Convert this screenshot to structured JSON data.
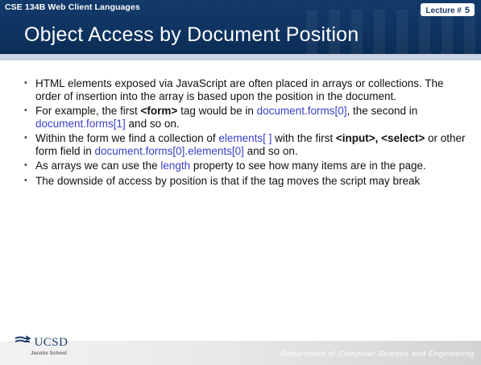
{
  "header": {
    "course": "CSE 134B  Web Client Languages",
    "lecture_label": "Lecture #",
    "lecture_number": "5",
    "title": "Object Access by Document Position"
  },
  "bullets": [
    {
      "parts": [
        {
          "text": "HTML elements exposed via JavaScript are often placed in arrays or collections.  The order of insertion into the array is based upon the position in the document."
        }
      ]
    },
    {
      "parts": [
        {
          "text": "For example, the first "
        },
        {
          "text": "<form>",
          "style": "bold"
        },
        {
          "text": " tag would be in "
        },
        {
          "text": "document.forms[0]",
          "style": "code"
        },
        {
          "text": ", the second in "
        },
        {
          "text": "document.forms[1]",
          "style": "code"
        },
        {
          "text": " and so on."
        }
      ]
    },
    {
      "parts": [
        {
          "text": "Within the form we find a collection of "
        },
        {
          "text": "elements[ ]",
          "style": "code"
        },
        {
          "text": " with the first "
        },
        {
          "text": "<input>, <select>",
          "style": "bold"
        },
        {
          "text": " or other form field in "
        },
        {
          "text": "document.forms[0].elements[0]",
          "style": "code"
        },
        {
          "text": " and so on."
        }
      ]
    },
    {
      "parts": [
        {
          "text": "As arrays we can use the "
        },
        {
          "text": "length",
          "style": "code"
        },
        {
          "text": " property to see how many items are in the page."
        }
      ]
    },
    {
      "parts": [
        {
          "text": "The downside of access by position is that if the tag moves the script may break"
        }
      ]
    }
  ],
  "footer": {
    "logo_text": "UCSD",
    "logo_sub": "Jacobs School",
    "department": "Department of Computer Science and Engineering"
  },
  "colors": {
    "header": "#0f3461",
    "code_text": "#3a3fc6",
    "band": "#c9d4e4"
  },
  "icons": {
    "bullet": "bullet-dot",
    "logo_mark": "ucsd-triton-logo"
  }
}
